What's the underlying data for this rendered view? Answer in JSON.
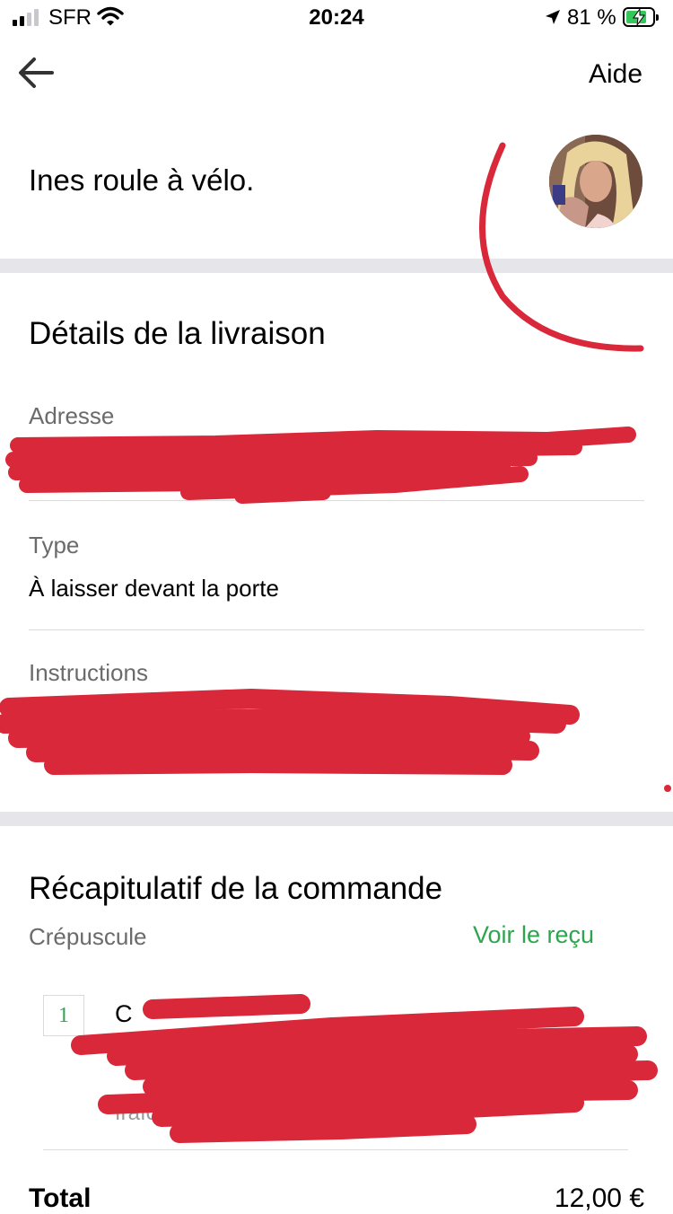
{
  "status_bar": {
    "carrier": "SFR",
    "time": "20:24",
    "battery_percent": "81 %",
    "battery_level": 0.81,
    "signal_bars": 2
  },
  "nav": {
    "back_icon": "arrow-left-icon",
    "help_label": "Aide"
  },
  "courier": {
    "status": "Ines roule à vélo."
  },
  "delivery": {
    "title": "Détails de la livraison",
    "address_label": "Adresse",
    "type_label": "Type",
    "type_value": "À laisser devant la porte",
    "instructions_label": "Instructions"
  },
  "order": {
    "title": "Récapitulatif de la commande",
    "restaurant": "Crépuscule",
    "receipt_link": "Voir le reçu",
    "item": {
      "quantity": "1",
      "name_visible": "C",
      "detail_fragment": "fraîche"
    },
    "total_label": "Total",
    "total_value": "12,00 €"
  },
  "colors": {
    "accent_green": "#2fa44f",
    "separator": "#e6e6ea",
    "redaction": "#d8283a"
  }
}
